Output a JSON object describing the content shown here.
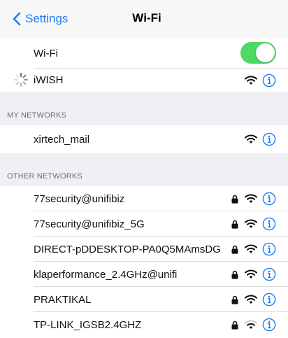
{
  "nav": {
    "back_label": "Settings",
    "title": "Wi-Fi"
  },
  "wifi_toggle": {
    "label": "Wi-Fi",
    "on": true
  },
  "current_network": {
    "name": "iWISH",
    "connecting": true
  },
  "sections": {
    "my_networks": "MY NETWORKS",
    "other_networks": "OTHER NETWORKS"
  },
  "my_networks": [
    {
      "name": "xirtech_mail",
      "locked": false,
      "signal": 3
    }
  ],
  "other_networks": [
    {
      "name": "77security@unifibiz",
      "locked": true,
      "signal": 3
    },
    {
      "name": "77security@unifibiz_5G",
      "locked": true,
      "signal": 3
    },
    {
      "name": "DIRECT-pDDESKTOP-PA0Q5MAmsDG",
      "locked": true,
      "signal": 3
    },
    {
      "name": "klaperformance_2.4GHz@unifi",
      "locked": true,
      "signal": 3
    },
    {
      "name": "PRAKTIKAL",
      "locked": true,
      "signal": 3
    },
    {
      "name": "TP-LINK_IGSB2.4GHZ",
      "locked": true,
      "signal": 2
    }
  ],
  "colors": {
    "accent": "#1a7cf5",
    "toggle_on": "#4cd964",
    "section_bg": "#efeff4"
  },
  "icons": {
    "back": "chevron-left-icon",
    "wifi": "wifi-icon",
    "lock": "lock-icon",
    "info": "info-icon",
    "spinner": "loading-spinner-icon"
  }
}
